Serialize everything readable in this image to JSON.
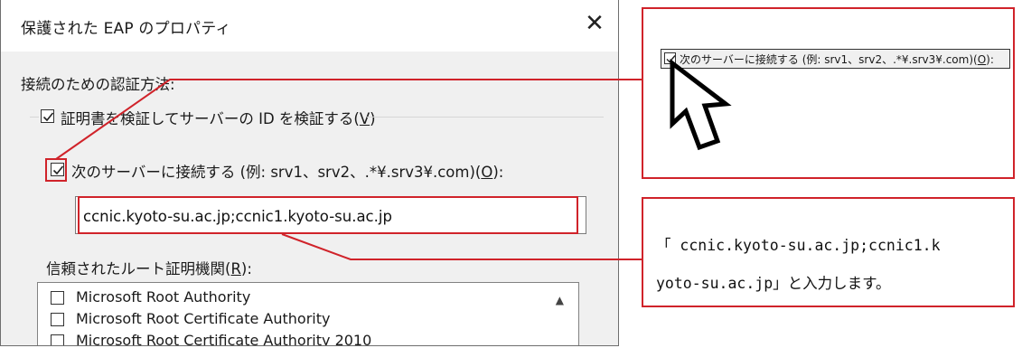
{
  "dialog": {
    "title": "保護された EAP のプロパティ",
    "close_glyph": "✕",
    "auth_method_label": "接続のための認証方法:",
    "verify_cert": {
      "label_prefix": "証明書を検証してサーバーの ID を検証する(",
      "accel": "V",
      "label_suffix": ")",
      "checked": true
    },
    "connect_servers": {
      "label_prefix": "次のサーバーに接続する (例: srv1、srv2、.*¥.srv3¥.com)(",
      "accel": "O",
      "label_suffix": "):",
      "checked": true
    },
    "server_field_value": "ccnic.kyoto-su.ac.jp;ccnic1.kyoto-su.ac.jp",
    "trusted_root_label_prefix": "信頼されたルート証明機関(",
    "trusted_root_accel": "R",
    "trusted_root_label_suffix": "):",
    "root_list": [
      {
        "label": "Microsoft Root Authority",
        "checked": false
      },
      {
        "label": "Microsoft Root Certificate Authority",
        "checked": false
      },
      {
        "label": "Microsoft Root Certificate Authority 2010",
        "checked": false
      }
    ]
  },
  "zoom_callout": {
    "label_prefix": "次のサーバーに接続する (例: srv1、srv2、.*¥.srv3¥.com)(",
    "accel": "O",
    "label_suffix": "):",
    "checked": true
  },
  "instruction": {
    "line1": "「 ccnic.kyoto-su.ac.jp;ccnic1.k",
    "line2": "yoto-su.ac.jp」と入力します。"
  },
  "colors": {
    "annotation_red": "#d0232a",
    "dialog_bg": "#f0f0f0",
    "title_bg": "#ffffff"
  }
}
